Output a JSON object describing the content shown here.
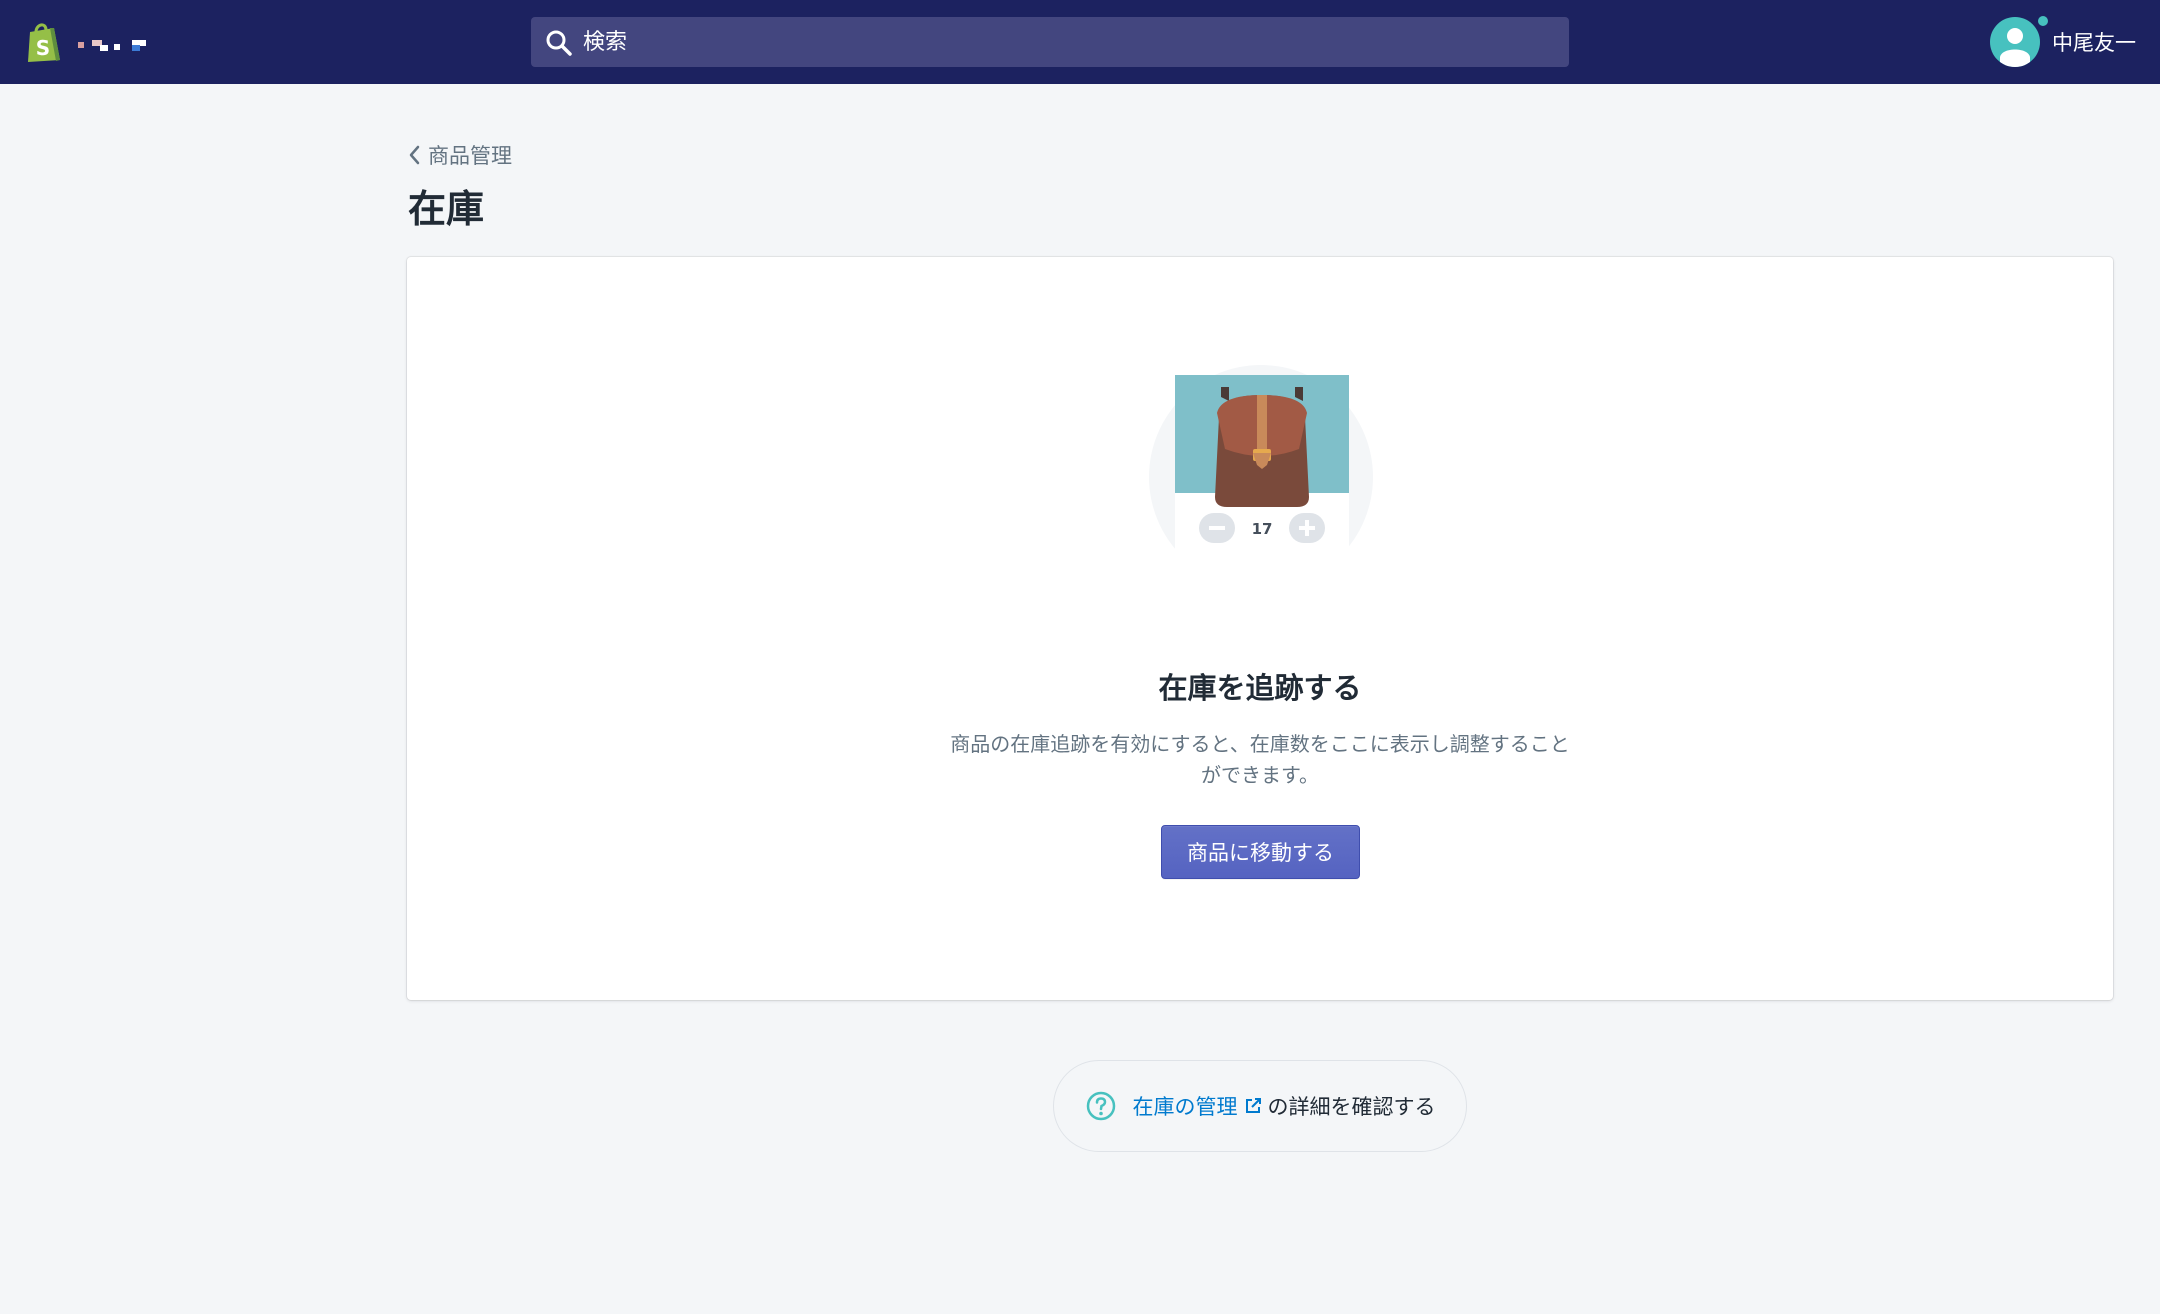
{
  "topbar": {
    "search": {
      "placeholder": "検索"
    },
    "user": {
      "name": "中尾友一"
    }
  },
  "breadcrumb": {
    "label": "商品管理"
  },
  "page": {
    "title": "在庫"
  },
  "empty_state": {
    "illustration": {
      "quantity": "17"
    },
    "heading": "在庫を追跡する",
    "description": "商品の在庫追跡を有効にすると、在庫数をここに表示し調整することができます。",
    "button_label": "商品に移動する"
  },
  "footer_help": {
    "link_text": "在庫の管理",
    "suffix_text": "の詳細を確認する"
  },
  "colors": {
    "topbar": "#1c2260",
    "search_bg": "#43467f",
    "primary": "#5c6ac4",
    "link": "#007ace",
    "teal": "#47c1bf"
  }
}
